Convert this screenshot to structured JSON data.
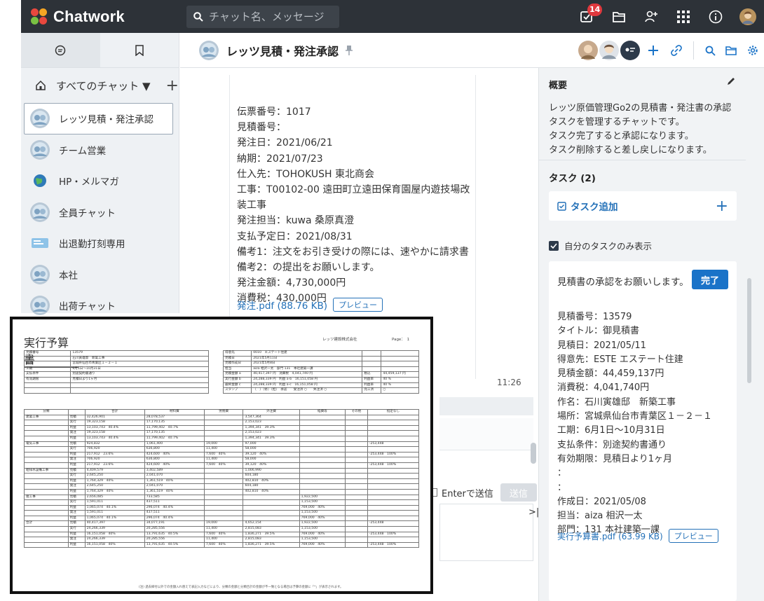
{
  "app": {
    "name": "Chatwork",
    "search_placeholder": "チャット名、メッセージ",
    "notif_count": "14"
  },
  "sidebar": {
    "all_chats": "すべてのチャット ▼",
    "rooms": [
      {
        "name": "レッツ見積・発注承認",
        "avatar": "room-icon",
        "active": true
      },
      {
        "name": "チーム営業",
        "avatar": "room-icon"
      },
      {
        "name": "HP・メルマガ",
        "avatar": "globe-icon"
      },
      {
        "name": "全員チャット",
        "avatar": "room-icon"
      },
      {
        "name": "出退勤打刻専用",
        "avatar": "timecard-icon"
      },
      {
        "name": "本社",
        "avatar": "room-icon"
      },
      {
        "name": "出荷チャット",
        "avatar": "room-icon"
      }
    ]
  },
  "room": {
    "title": "レッツ見積・発注承認"
  },
  "message": {
    "lines": [
      "伝票番号：1017",
      "見積番号：",
      "発注日：2021/06/21",
      "納期：2021/07/23",
      "仕入先：TOHOKUSH 東北商会",
      "工事：T00102-00 遠田町立遠田保育園屋内遊技場改装工事",
      "発注担当：kuwa 桑原真澄",
      "支払予定日：2021/08/31",
      "備考1：注文をお引き受けの際には、速やかに請求書",
      "備考2：の提出をお願いします。",
      "発注金額：4,730,000円",
      "消費税：430,000円"
    ],
    "file": "発注.pdf (88.76 KB)",
    "preview_label": "プレビュー",
    "time": "11:26"
  },
  "composer": {
    "enter_send": "Enterで送信",
    "send_label": "送信"
  },
  "panel": {
    "overview_title": "概要",
    "overview_lines": [
      "レッツ原価管理Go2の見積書・発注書の承認",
      "タスクを管理するチャットです。",
      "タスク完了すると承認になります。",
      "タスク削除すると差し戻しになります。"
    ],
    "task_title": "タスク (2)",
    "task_add": "タスク追加",
    "mine_only": "自分のタスクのみ表示",
    "task": {
      "head": "見積書の承認をお願いします。",
      "done": "完了",
      "lines": [
        "見積番号：13579",
        "タイトル：御見積書",
        "見積日：2021/05/11",
        "得意先：ESTE エステート住建",
        "見積金額：44,459,137円",
        "消費税：4,041,740円",
        "作名：石川寅雄邸　新築工事",
        "場所：宮城県仙台市青葉区１－２－１",
        "工期：6月1日～10月31日",
        "支払条件：別途契約書通り",
        "有効期限：見積日より1ヶ月",
        "：",
        "：",
        "作成日：2021/05/08",
        "担当：aiza 相沢一太",
        "部門：131 本社建築一課"
      ],
      "file": "実行予算書.pdf (63.99 KB)",
      "preview": "プレビュー"
    }
  },
  "doc": {
    "title": "実行予算書",
    "company": "レッツ建設株式会社",
    "page": "Page：　1",
    "left_table": [
      [
        "見積番号",
        "13579"
      ],
      [
        "件名",
        "石川寅雄邸　新築工事"
      ],
      [
        "場所",
        "宮城県仙台市青葉区１－２－１"
      ],
      [
        "工期",
        "6月1日～10月31日"
      ],
      [
        "支払条件",
        "別途契約書通り"
      ],
      [
        "有効期限",
        "見積日より1ヶ月"
      ],
      [
        "",
        ""
      ],
      [
        "",
        ""
      ]
    ],
    "right_table": [
      [
        "得意先",
        "0010　エステート住建",
        "",
        ""
      ],
      [
        "見積日",
        "2021年5月11日",
        "",
        ""
      ],
      [
        "見積作成日",
        "2021年5月8日",
        "",
        ""
      ],
      [
        "担当",
        "aiza 相沢一太　部門 131　本社建築一課",
        "",
        ""
      ],
      [
        "見積金額 a",
        "40,417,397 円　消費税　4,041,740 円",
        "税込",
        "44,459,137 円"
      ],
      [
        "実行金額 b",
        "24,288,339 円　利益 a-b　16,151,058 円",
        "利益率",
        "40 %"
      ],
      [
        "最終金額 c",
        "24,288,339 円　利益 a-c　16,151,058 円",
        "利益率",
        "40 %"
      ],
      [
        "スタンプ",
        "〔　〕〔修〕〔担〕　承認　　受注済 ○　　失注済 ○",
        "完工済",
        "○"
      ]
    ],
    "main_header": [
      "分類",
      "",
      "合計",
      "材料費",
      "労務費",
      "外注費",
      "経費等",
      "その他",
      "指定なし"
    ],
    "main_rows": [
      [
        "建築工事",
        "見積",
        "32,426,901",
        "28,078,537",
        "",
        "3,547,364",
        "",
        "",
        ""
      ],
      [
        "",
        "実行",
        "19,323,158",
        "17,170,135",
        "",
        "2,153,023",
        "",
        "",
        ""
      ],
      [
        "",
        "利益",
        "13,103,743　40.4%",
        "11,799,402　40.7%",
        "",
        "1,394,341　39.3%",
        "",
        "",
        ""
      ],
      [
        "",
        "発注",
        "19,323,158",
        "17,170,135",
        "",
        "2,153,023",
        "",
        "",
        ""
      ],
      [
        "",
        "利益",
        "13,103,743　40.4%",
        "11,799,402　40.7%",
        "",
        "1,394,341　39.3%",
        "",
        "",
        ""
      ],
      [
        "電気工事",
        "見積",
        "924,832",
        "1,061,400",
        "19,000",
        "97,000",
        "",
        "",
        "-253,448"
      ],
      [
        "",
        "実行",
        "706,920",
        "636,800",
        "11,400",
        "58,000",
        "",
        "",
        ""
      ],
      [
        "",
        "利益",
        "217,912　23.6%",
        "424,600　40%",
        "7,600　40%",
        "39,120　40%",
        "",
        "",
        "-253,448　100%"
      ],
      [
        "",
        "発注",
        "706,920",
        "636,800",
        "11,400",
        "58,000",
        "",
        "",
        ""
      ],
      [
        "",
        "利益",
        "217,912　23.6%",
        "424,600　40%",
        "7,600　40%",
        "39,120　40%",
        "",
        "",
        "-253,448　100%"
      ],
      [
        "給排水設備工事",
        "見積",
        "4,409,579",
        "3,402,589",
        "",
        "1,006,990",
        "",
        "",
        ""
      ],
      [
        "",
        "実行",
        "2,645,250",
        "2,041,070",
        "",
        "604,180",
        "",
        "",
        ""
      ],
      [
        "",
        "利益",
        "1,764,329　40%",
        "1,361,519　40%",
        "",
        "402,810　40%",
        "",
        "",
        ""
      ],
      [
        "",
        "発注",
        "2,645,250",
        "2,041,070",
        "",
        "604,180",
        "",
        "",
        ""
      ],
      [
        "",
        "利益",
        "1,764,329　40%",
        "1,361,519　40%",
        "",
        "402,810　40%",
        "",
        "",
        ""
      ],
      [
        "雑工事",
        "見積",
        "2,656,085",
        "733,585",
        "",
        "",
        "1,922,500",
        "",
        ""
      ],
      [
        "",
        "実行",
        "1,591,011",
        "437,511",
        "",
        "",
        "1,153,500",
        "",
        ""
      ],
      [
        "",
        "利益",
        "1,065,074　40.1%",
        "296,074　40.4%",
        "",
        "",
        "769,000　40%",
        "",
        ""
      ],
      [
        "",
        "発注",
        "1,591,011",
        "437,511",
        "",
        "",
        "1,153,500",
        "",
        ""
      ],
      [
        "",
        "利益",
        "1,065,074　40.1%",
        "296,074　40.4%",
        "",
        "",
        "769,000　40%",
        "",
        ""
      ],
      [
        "合計",
        "見積",
        "40,417,397",
        "34,077,191",
        "19,000",
        "4,652,154",
        "1,922,500",
        "",
        "-253,448"
      ],
      [
        "",
        "実行",
        "24,266,339",
        "20,285,556",
        "11,400",
        "2,815,083",
        "1,153,500",
        "",
        ""
      ],
      [
        "",
        "利益",
        "16,151,058　40%",
        "13,791,635　40.5%",
        "7,600　40%",
        "1,836,271　39.5%",
        "769,000　40%",
        "",
        "-253,448　100%"
      ],
      [
        "",
        "発注",
        "24,266,339",
        "20,285,556",
        "11,400",
        "2,815,083",
        "1,153,500",
        "",
        ""
      ],
      [
        "",
        "利益",
        "16,151,058　40%",
        "13,791,635　40.5%",
        "7,600　40%",
        "1,836,271　39.5%",
        "769,000　40%",
        "",
        "-253,448　100%"
      ]
    ],
    "footnote": "(注) 過去締付以外での金額入れ替えで表記入力などにより、分類の金額と分類合計の金額が不一致となる場合は予算の金額に「*」が表示されます。"
  },
  "colors": {
    "topbar": "#2d3238",
    "accent": "#1a73c8",
    "link": "#2471b8",
    "logo_red": "#e8483e",
    "logo_orange": "#f5a523",
    "logo_green": "#7ac143"
  }
}
